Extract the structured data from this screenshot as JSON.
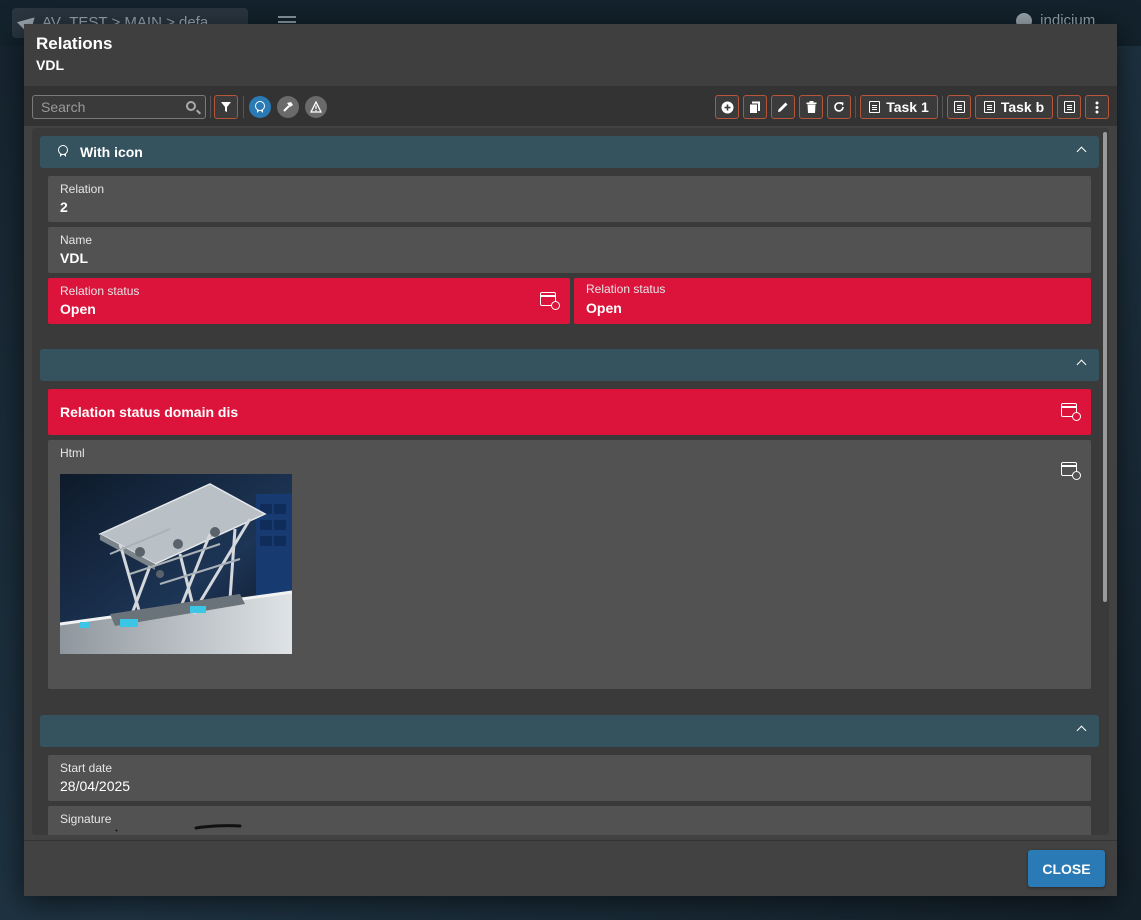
{
  "background": {
    "breadcrumb": "AV_TEST > MAIN > defa...",
    "user": "indicium"
  },
  "modal": {
    "title": "Relations",
    "subtitle": "VDL"
  },
  "toolbar": {
    "search_placeholder": "Search",
    "task1_label": "Task 1",
    "taskb_label": "Task b"
  },
  "sections": {
    "first": {
      "title": "With icon",
      "fields": {
        "relation": {
          "label": "Relation",
          "value": "2"
        },
        "name": {
          "label": "Name",
          "value": "VDL"
        },
        "relation_status_1": {
          "label": "Relation status",
          "value": "Open"
        },
        "relation_status_2": {
          "label": "Relation status",
          "value": "Open"
        }
      }
    },
    "second": {
      "title": "",
      "domain_field": "Relation status domain dis",
      "html_label": "Html"
    },
    "third": {
      "title": "",
      "fields": {
        "start_date": {
          "label": "Start date",
          "value": "28/04/2025"
        },
        "signature": {
          "label": "Signature"
        }
      }
    }
  },
  "footer": {
    "close_label": "CLOSE"
  },
  "colors": {
    "accent_blue": "#2a7ab5",
    "status_red": "#dc143c",
    "section_header": "#35525f"
  }
}
